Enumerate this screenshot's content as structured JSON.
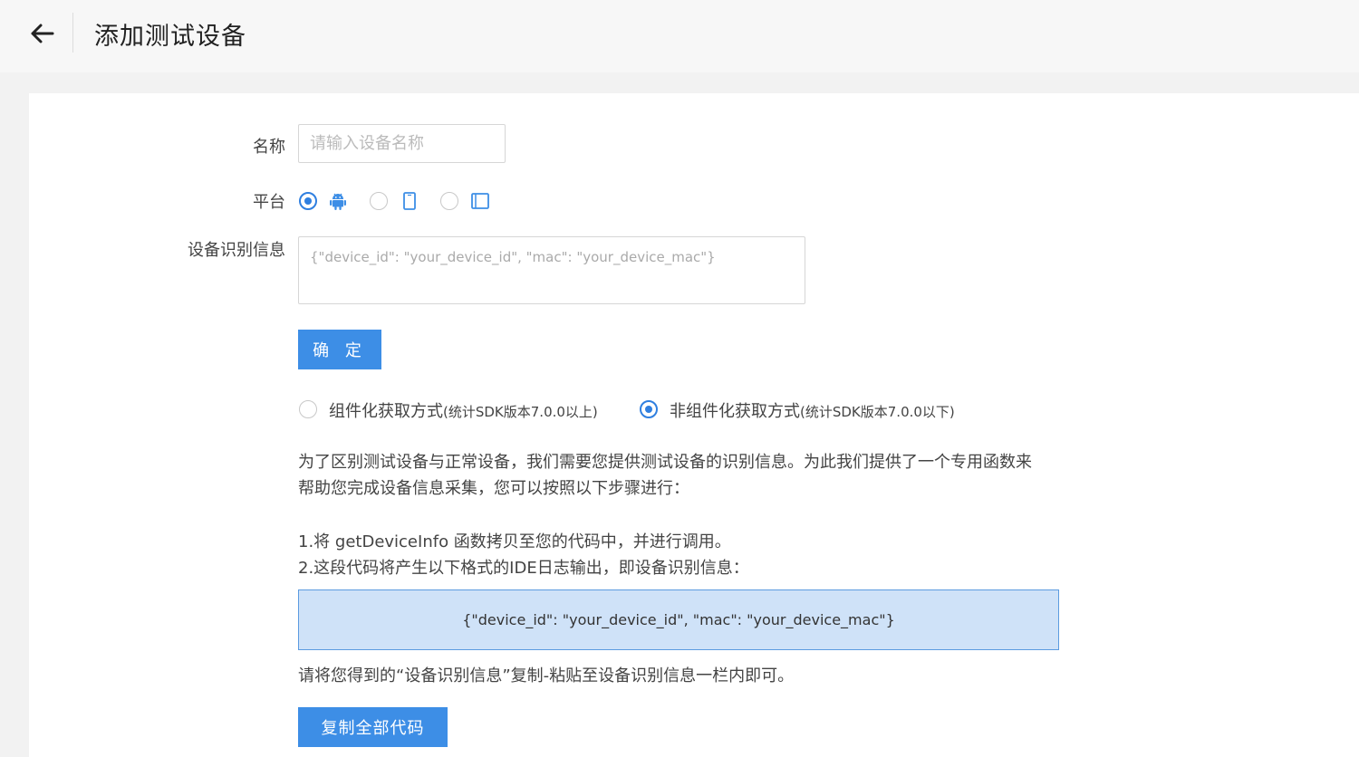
{
  "header": {
    "title": "添加测试设备",
    "back_icon": "arrow-left-icon"
  },
  "form": {
    "name_label": "名称",
    "name_placeholder": "请输入设备名称",
    "name_value": "",
    "platform_label": "平台",
    "platforms": [
      {
        "icon": "android-icon",
        "selected": true
      },
      {
        "icon": "phone-icon",
        "selected": false
      },
      {
        "icon": "tablet-icon",
        "selected": false
      }
    ],
    "device_info_label": "设备识别信息",
    "device_info_placeholder": "{\"device_id\": \"your_device_id\", \"mac\": \"your_device_mac\"}",
    "confirm_label": "确 定"
  },
  "modes": {
    "component_main": "组件化获取方式",
    "component_note": "(统计SDK版本7.0.0以上)",
    "non_component_main": "非组件化获取方式",
    "non_component_note": "(统计SDK版本7.0.0以下)",
    "selected": "non_component"
  },
  "instructions": {
    "intro_line1": "为了区别测试设备与正常设备，我们需要您提供测试设备的识别信息。为此我们提供了一个专用函数来",
    "intro_line2": "帮助您完成设备信息采集，您可以按照以下步骤进行：",
    "step1": "1.将 getDeviceInfo 函数拷贝至您的代码中，并进行调用。",
    "step2": "2.这段代码将产生以下格式的IDE日志输出，即设备识别信息：",
    "code_sample": "{\"device_id\": \"your_device_id\", \"mac\": \"your_device_mac\"}",
    "step3": "请将您得到的“设备识别信息”复制-粘贴至设备识别信息一栏内即可。",
    "copy_label": "复制全部代码"
  },
  "colors": {
    "accent": "#3d8ee6",
    "radio_active": "#2f7fe0",
    "code_bg": "#cfe2f8",
    "code_border": "#5b9be0"
  }
}
